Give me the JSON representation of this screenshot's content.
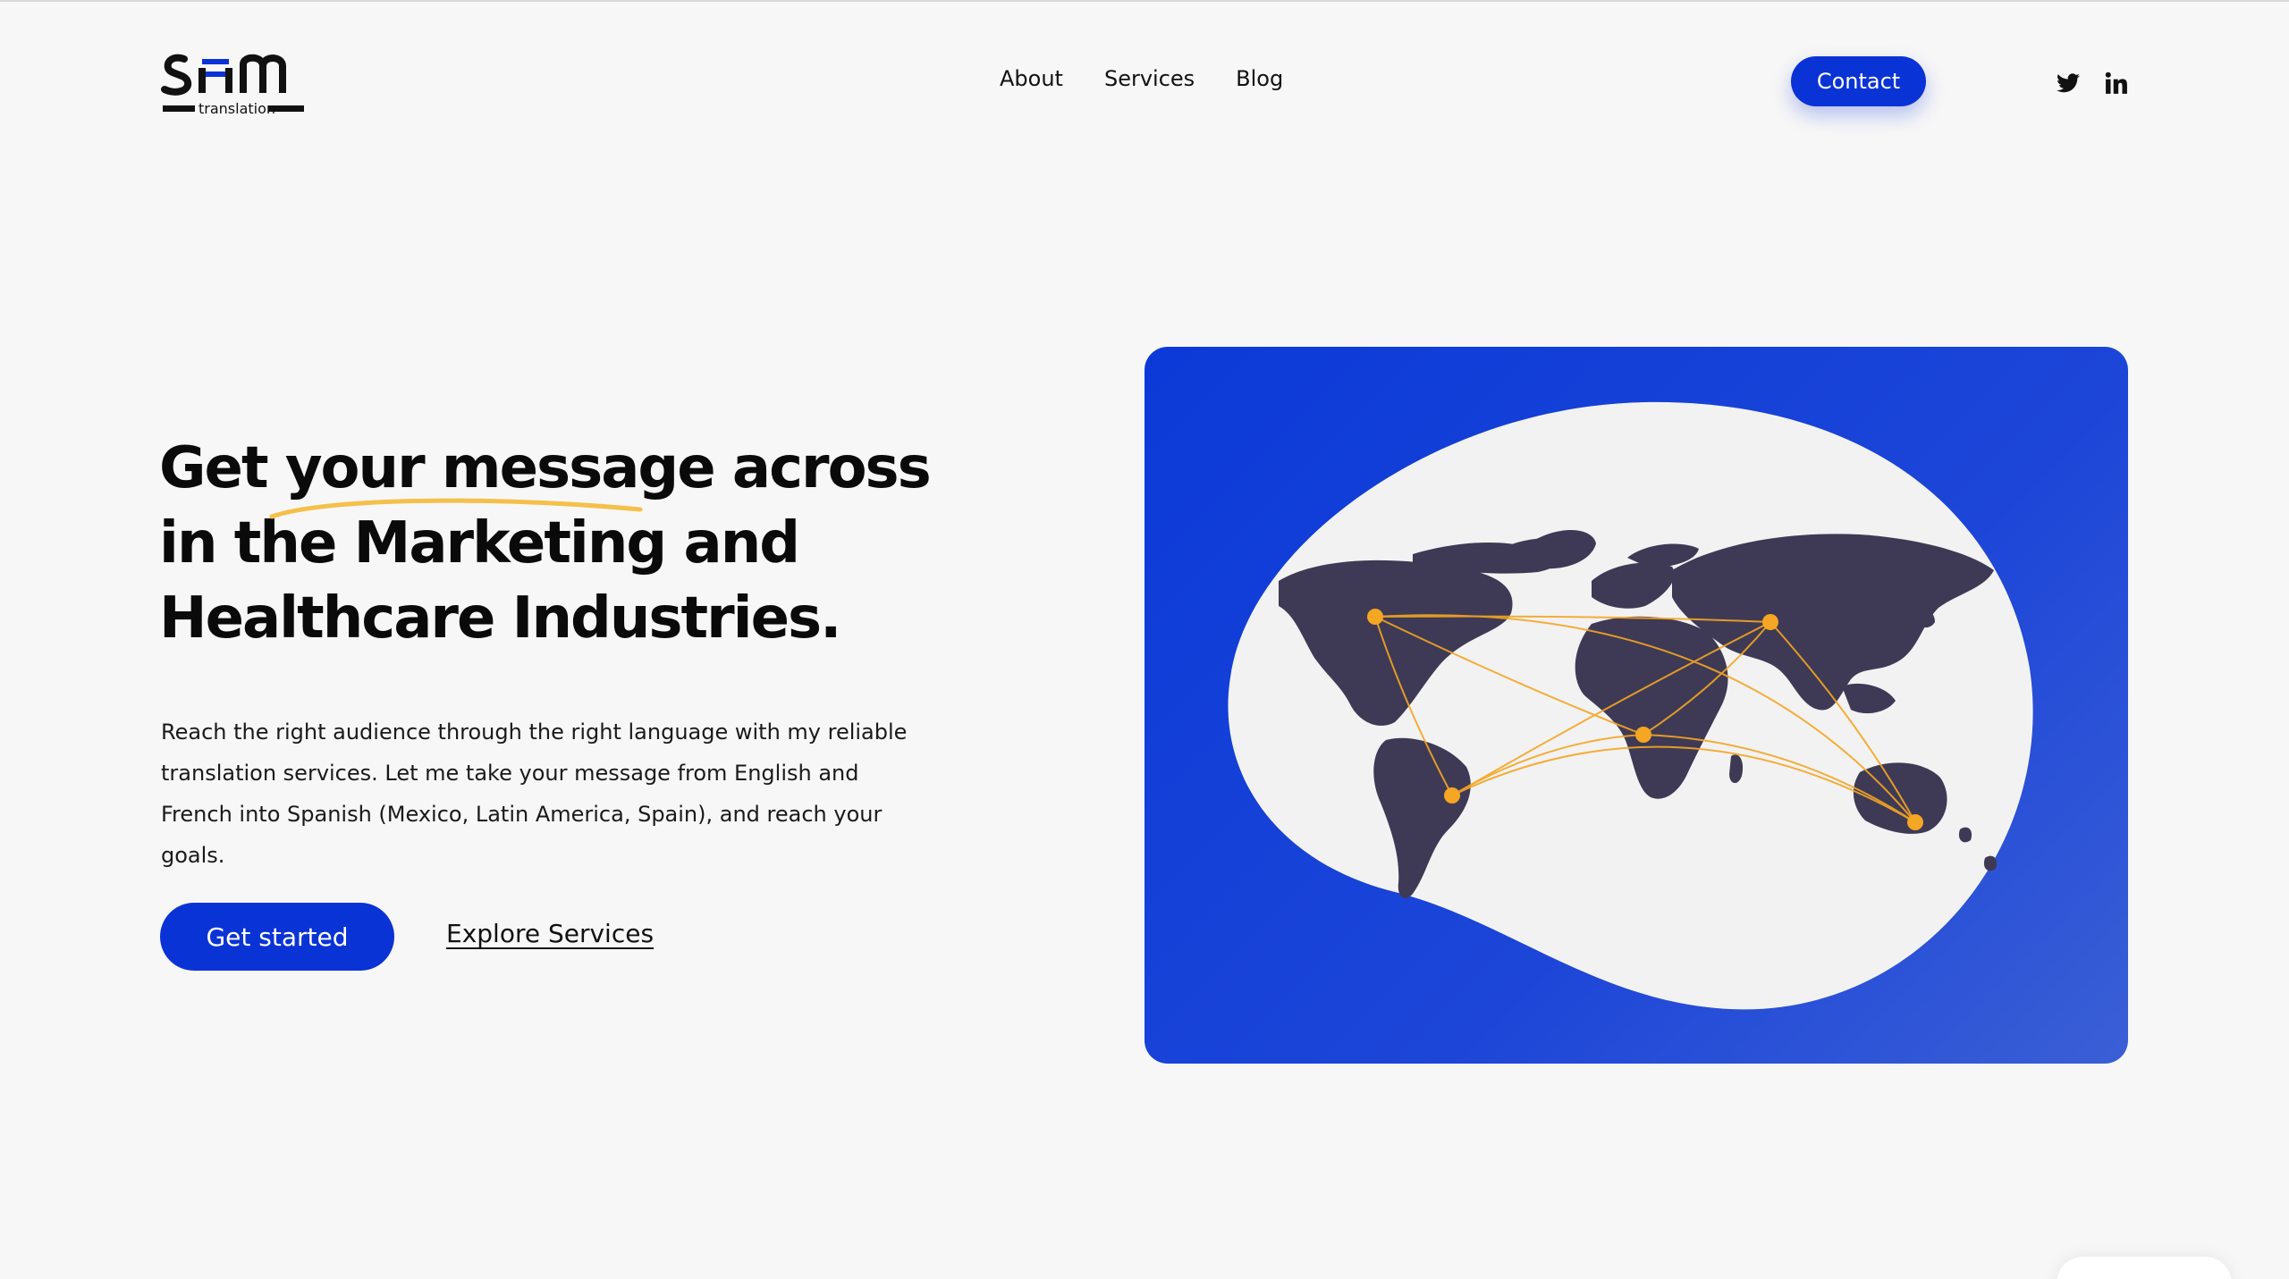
{
  "logo": {
    "mark": "sam",
    "sub": "translation"
  },
  "nav": {
    "items": [
      "About",
      "Services",
      "Blog"
    ]
  },
  "header": {
    "contact_label": "Contact"
  },
  "social": {
    "twitter_icon": "twitter-icon",
    "linkedin_icon": "linkedin-icon"
  },
  "hero": {
    "title_lines": [
      "Get your message across",
      "in the Marketing and",
      "Healthcare Industries."
    ],
    "description": "Reach the right audience through the right language with my reliable translation services. Let me take your message from English and French into Spanish (Mexico, Latin America, Spain), and reach your goals.",
    "primary_cta": "Get started",
    "secondary_cta": "Explore Services"
  },
  "colors": {
    "brand": "#0a33d6",
    "accent": "#f5c04a",
    "node": "#f5a623",
    "land": "#3e3a55"
  }
}
